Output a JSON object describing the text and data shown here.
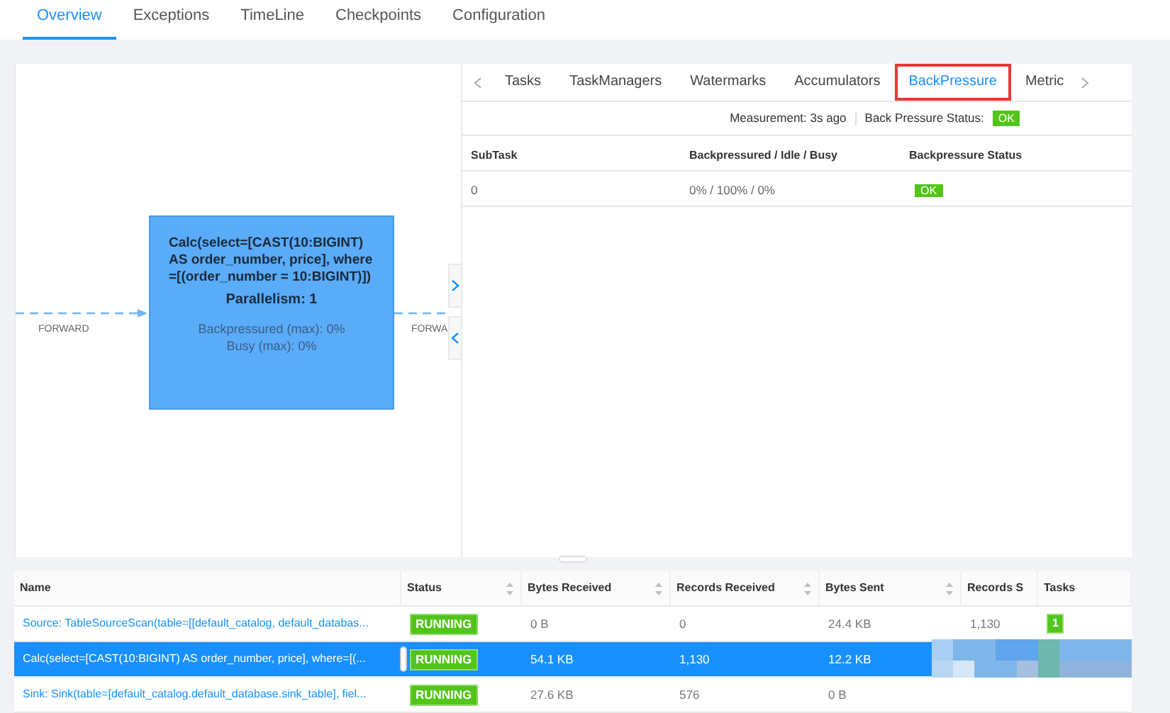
{
  "top_tabs": [
    {
      "label": "Overview",
      "selected": true
    },
    {
      "label": "Exceptions",
      "selected": false
    },
    {
      "label": "TimeLine",
      "selected": false
    },
    {
      "label": "Checkpoints",
      "selected": false
    },
    {
      "label": "Configuration",
      "selected": false
    }
  ],
  "graph": {
    "left_edge_label": "FORWARD",
    "right_edge_label": "FORWA",
    "node": {
      "title": "Calc(select=[CAST(10:BIGINT) AS order_number, price], where=[(order_number = 10:BIGINT)])",
      "parallelism": "Parallelism: 1",
      "backpressured": "Backpressured (max): 0%",
      "busy": "Busy (max): 0%"
    }
  },
  "detail_tabs": [
    {
      "label": "Tasks",
      "selected": false,
      "highlighted": false
    },
    {
      "label": "TaskManagers",
      "selected": false,
      "highlighted": false
    },
    {
      "label": "Watermarks",
      "selected": false,
      "highlighted": false
    },
    {
      "label": "Accumulators",
      "selected": false,
      "highlighted": false
    },
    {
      "label": "BackPressure",
      "selected": true,
      "highlighted": true
    },
    {
      "label": "Metric",
      "selected": false,
      "highlighted": false
    }
  ],
  "backpressure": {
    "measurement": "Measurement: 3s ago",
    "status_label": "Back Pressure Status:",
    "status": "OK",
    "columns": [
      "SubTask",
      "Backpressured / Idle / Busy",
      "Backpressure Status"
    ],
    "rows": [
      {
        "subtask": "0",
        "ratio": "0% / 100% / 0%",
        "status": "OK"
      }
    ]
  },
  "vertex_table": {
    "columns": [
      {
        "label": "Name",
        "sortable": false
      },
      {
        "label": "Status",
        "sortable": true
      },
      {
        "label": "Bytes Received",
        "sortable": true
      },
      {
        "label": "Records Received",
        "sortable": true
      },
      {
        "label": "Bytes Sent",
        "sortable": true
      },
      {
        "label": "Records S",
        "sortable": false
      },
      {
        "label": "Tasks",
        "sortable": false
      }
    ],
    "rows": [
      {
        "name": "Source: TableSourceScan(table=[[default_catalog, default_databas...",
        "status": "RUNNING",
        "bytes_received": "0 B",
        "records_received": "0",
        "bytes_sent": "24.4 KB",
        "records_sent": "1,130",
        "tasks": "1",
        "selected": false,
        "obscured": false
      },
      {
        "name": "Calc(select=[CAST(10:BIGINT) AS order_number, price], where=[(...",
        "status": "RUNNING",
        "bytes_received": "54.1 KB",
        "records_received": "1,130",
        "bytes_sent": "12.2 KB",
        "selected": true,
        "obscured": true
      },
      {
        "name": "Sink: Sink(table=[default_catalog.default_database.sink_table], fiel...",
        "status": "RUNNING",
        "bytes_received": "27.6 KB",
        "records_received": "576",
        "bytes_sent": "0 B",
        "selected": false,
        "obscured": false
      }
    ]
  }
}
